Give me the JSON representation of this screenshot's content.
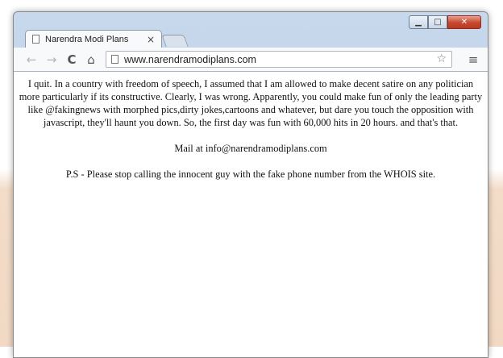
{
  "browser": {
    "tab_title": "Narendra Modi Plans",
    "tab_close": "×",
    "url": "www.narendramodiplans.com",
    "icons": {
      "back": "back-arrow-icon",
      "forward": "forward-arrow-icon",
      "reload": "reload-icon",
      "home": "home-icon",
      "bookmark": "star-icon",
      "menu": "menu-icon",
      "page": "page-icon"
    },
    "window_controls": {
      "minimize": "▁",
      "maximize": "□",
      "close": "✕"
    }
  },
  "page": {
    "paragraph1": "I quit. In a country with freedom of speech, I assumed that I am allowed to make decent satire on any politician more particularly if its constructive. Clearly, I was wrong. Apparently, you could make fun of only the leading party like @fakingnews with morphed pics,dirty jokes,cartoons and whatever, but dare you touch the opposition with javascript, they'll haunt you down. So, the first day was fun with 60,000 hits in 20 hours. and that's that.",
    "mail": "Mail at info@narendramodiplans.com",
    "ps": "P.S - Please stop calling the innocent guy with the fake phone number from the WHOIS site."
  }
}
